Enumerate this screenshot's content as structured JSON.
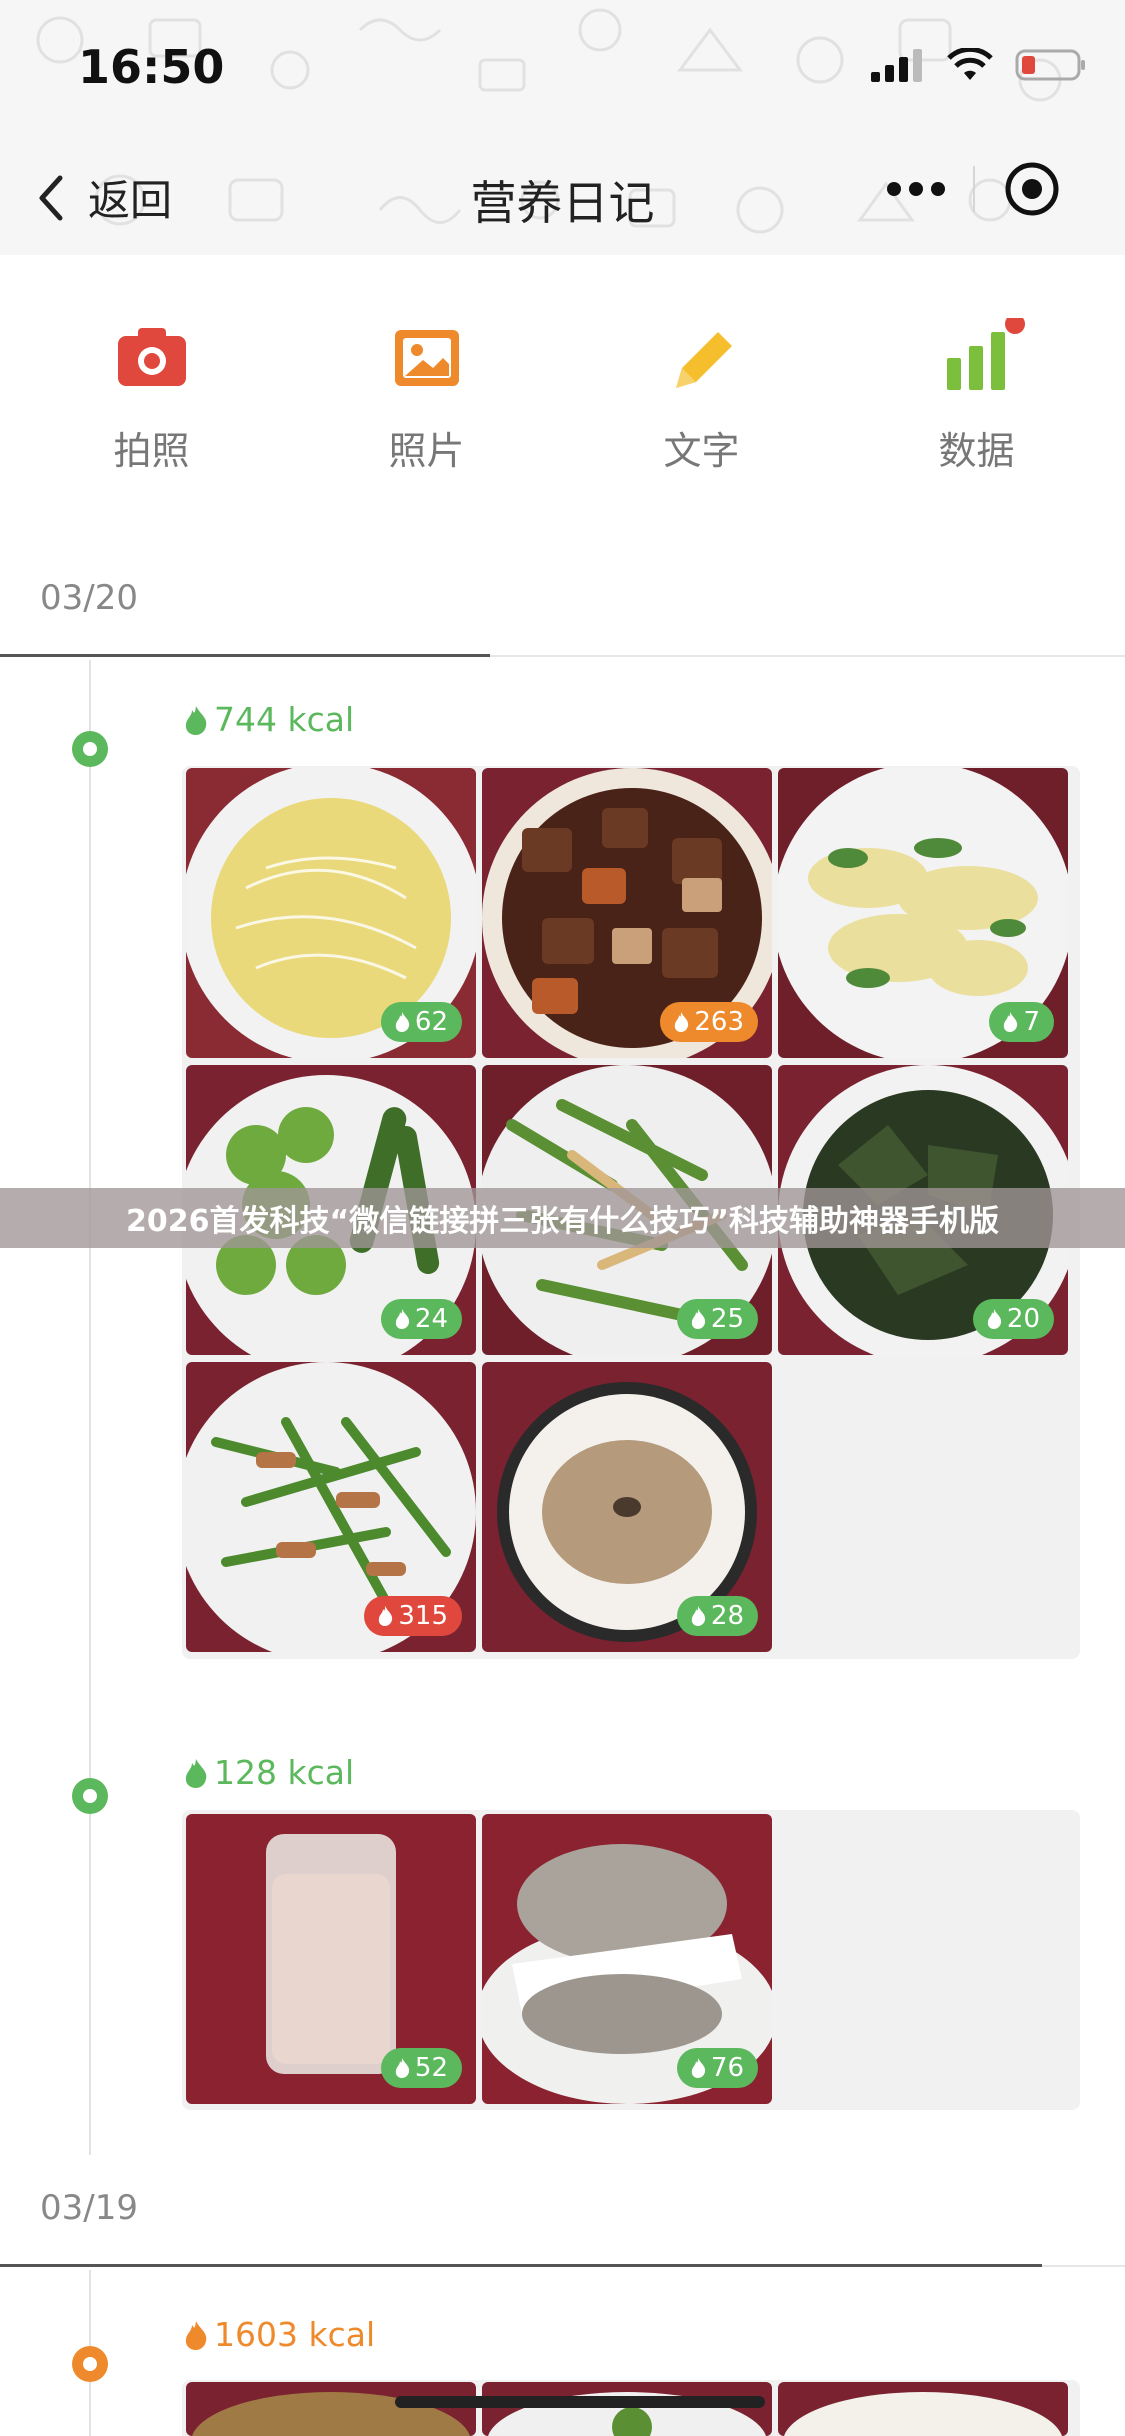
{
  "status_bar": {
    "time": "16:50"
  },
  "nav": {
    "back_label": "返回",
    "title": "营养日记"
  },
  "toolbar": {
    "items": [
      {
        "label": "拍照",
        "icon": "camera-icon",
        "color": "#e0483e"
      },
      {
        "label": "照片",
        "icon": "image-icon",
        "color": "#ef8a2c"
      },
      {
        "label": "文字",
        "icon": "pencil-icon",
        "color": "#f4be2c"
      },
      {
        "label": "数据",
        "icon": "bar-chart-icon",
        "color": "#7cbf3c",
        "notification_dot": true
      }
    ]
  },
  "days": [
    {
      "date": "03/20",
      "meals": [
        {
          "kcal": "744 kcal",
          "color": "#5cb85c",
          "photos": [
            {
              "name": "noodle-soup",
              "kcal": "62",
              "badge_color": "#5cb85c"
            },
            {
              "name": "braised-beef-potato",
              "kcal": "263",
              "badge_color": "#ef8a2c"
            },
            {
              "name": "stir-fried-cabbage",
              "kcal": "7",
              "badge_color": "#5cb85c"
            },
            {
              "name": "broccoli-okra",
              "kcal": "24",
              "badge_color": "#5cb85c"
            },
            {
              "name": "green-beans-tofu",
              "kcal": "25",
              "badge_color": "#5cb85c"
            },
            {
              "name": "kelp-salad",
              "kcal": "20",
              "badge_color": "#5cb85c"
            },
            {
              "name": "garlic-sprout-pork",
              "kcal": "315",
              "badge_color": "#e0483e"
            },
            {
              "name": "bagel-bowl",
              "kcal": "28",
              "badge_color": "#5cb85c"
            }
          ]
        },
        {
          "kcal": "128 kcal",
          "color": "#5cb85c",
          "photos": [
            {
              "name": "soy-milk",
              "kcal": "52",
              "badge_color": "#5cb85c"
            },
            {
              "name": "bagel-sandwich",
              "kcal": "76",
              "badge_color": "#5cb85c"
            }
          ]
        }
      ]
    },
    {
      "date": "03/19",
      "meals": [
        {
          "kcal": "1603 kcal",
          "color": "#ef8a2c",
          "photos": []
        }
      ]
    }
  ],
  "banner": {
    "text": "2026首发科技“微信链接拼三张有什么技巧”科技辅助神器手机版"
  }
}
